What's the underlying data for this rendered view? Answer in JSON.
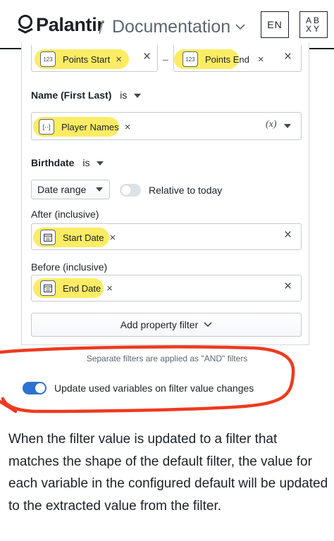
{
  "header": {
    "brand": "Palantir",
    "separator": "/",
    "section": "Documentation",
    "lang_button": "EN",
    "icon_button_top": "AB",
    "icon_button_bottom": "XY"
  },
  "points_filter": {
    "start_icon": "123",
    "start_label": "Points Start",
    "dash": "–",
    "end_icon": "123",
    "end_label": "Points End",
    "remove_glyph": "×"
  },
  "name_filter": {
    "title": "Name (First Last)",
    "operator": "is",
    "tag_label": "Player Names",
    "variable_glyph": "(x)"
  },
  "birthdate_filter": {
    "title": "Birthdate",
    "operator": "is",
    "mode_select": "Date range",
    "relative_label": "Relative to today",
    "after_label": "After (inclusive)",
    "after_tag": "Start Date",
    "before_label": "Before (inclusive)",
    "before_tag": "End Date"
  },
  "add_filter_button": "Add property filter",
  "separate_note": "Separate filters are applied as \"AND\" filters",
  "update_toggle": {
    "label": "Update used variables on filter value changes",
    "enabled": true
  },
  "description": "When the filter value is updated to a filter that matches the shape of the default filter, the value for each variable in the configured default will be updated to the extracted value from the filter.",
  "colors": {
    "highlight": "#fbe94a",
    "toggle_on": "#2d72d2",
    "annotation_red": "#ee3a1e"
  }
}
